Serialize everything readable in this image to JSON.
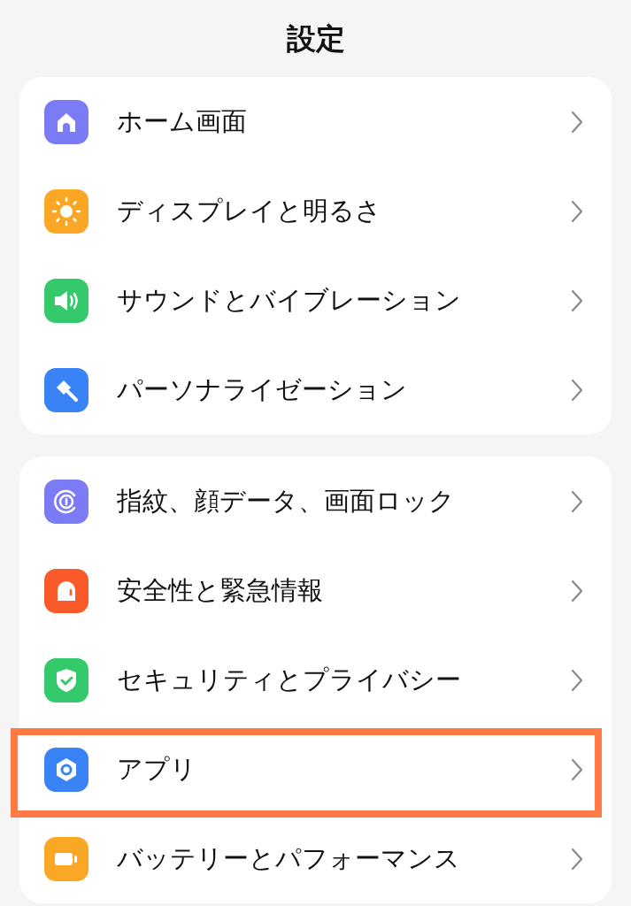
{
  "header": {
    "title": "設定"
  },
  "groups": [
    {
      "items": [
        {
          "label": "ホーム画面",
          "color": "#7b7bf5",
          "highlighted": false
        },
        {
          "label": "ディスプレイと明るさ",
          "color": "#fba726",
          "highlighted": false
        },
        {
          "label": "サウンドとバイブレーション",
          "color": "#34c96a",
          "highlighted": false
        },
        {
          "label": "パーソナライゼーション",
          "color": "#3a83f6",
          "highlighted": false
        }
      ]
    },
    {
      "items": [
        {
          "label": "指紋、顔データ、画面ロック",
          "color": "#7b7bf5",
          "highlighted": false
        },
        {
          "label": "安全性と緊急情報",
          "color": "#fa5a2a",
          "highlighted": false
        },
        {
          "label": "セキュリティとプライバシー",
          "color": "#34c96a",
          "highlighted": false
        },
        {
          "label": "アプリ",
          "color": "#3a83f6",
          "highlighted": true
        },
        {
          "label": "バッテリーとパフォーマンス",
          "color": "#fba726",
          "highlighted": false
        }
      ]
    }
  ]
}
